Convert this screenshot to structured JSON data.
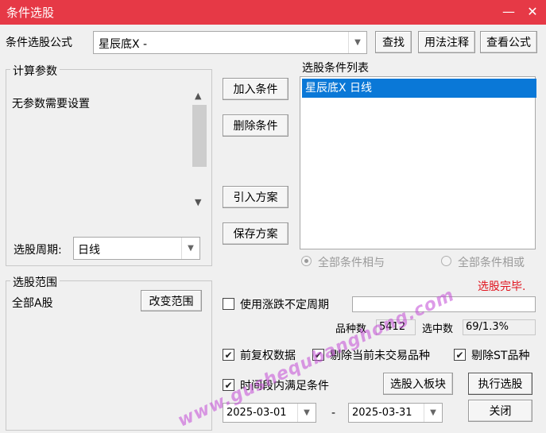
{
  "window": {
    "title": "条件选股"
  },
  "formula": {
    "label": "条件选股公式",
    "value": "星辰底X  -",
    "find_btn": "查找",
    "usage_btn": "用法注释",
    "view_btn": "查看公式"
  },
  "params": {
    "group_label": "计算参数",
    "text": "无参数需要设置",
    "period_label": "选股周期:",
    "period_value": "日线"
  },
  "buttons": {
    "add": "加入条件",
    "delete": "删除条件",
    "import": "引入方案",
    "save": "保存方案",
    "change_range": "改变范围",
    "to_block": "选股入板块",
    "execute": "执行选股",
    "close": "关闭"
  },
  "conditions": {
    "label": "选股条件列表",
    "items": [
      "星辰底X  日线"
    ]
  },
  "logic": {
    "and_label": "全部条件相与",
    "or_label": "全部条件相或"
  },
  "status": {
    "text": "选股完毕.",
    "color": "#e0141e"
  },
  "range": {
    "group_label": "选股范围",
    "value": "全部A股"
  },
  "options": {
    "uncertain_period": "使用涨跌不定周期",
    "forward_adjust": "前复权数据",
    "exclude_untraded": "剔除当前未交易品种",
    "exclude_st": "剔除ST品种",
    "time_range": "时间段内满足条件"
  },
  "stats": {
    "count_label": "品种数",
    "count_value": "5412",
    "selected_label": "选中数",
    "selected_value": "69/1.3%"
  },
  "dates": {
    "start": "2025-03-01",
    "separator": "-",
    "end": "2025-03-31"
  },
  "watermark": "www.gushequbanghong.com"
}
